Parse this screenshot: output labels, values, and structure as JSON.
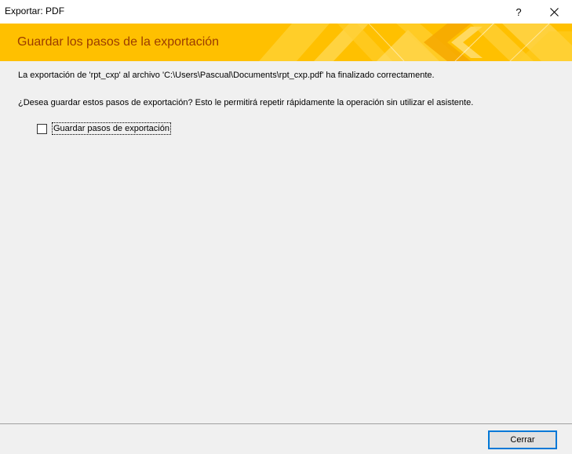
{
  "window": {
    "title": "Exportar: PDF",
    "help_glyph": "?",
    "close_icon": "close-icon"
  },
  "banner": {
    "title": "Guardar los pasos de la exportación",
    "accent": "#ffc000",
    "title_color": "#9b3c00"
  },
  "messages": {
    "success": "La exportación de 'rpt_cxp' al archivo 'C:\\Users\\Pascual\\Documents\\rpt_cxp.pdf' ha finalizado correctamente.",
    "question": "¿Desea guardar estos pasos de exportación? Esto le permitirá repetir rápidamente la operación sin utilizar el asistente."
  },
  "options": {
    "save_steps_label": "Guardar pasos de exportación",
    "save_steps_checked": false
  },
  "footer": {
    "close_label": "Cerrar"
  }
}
